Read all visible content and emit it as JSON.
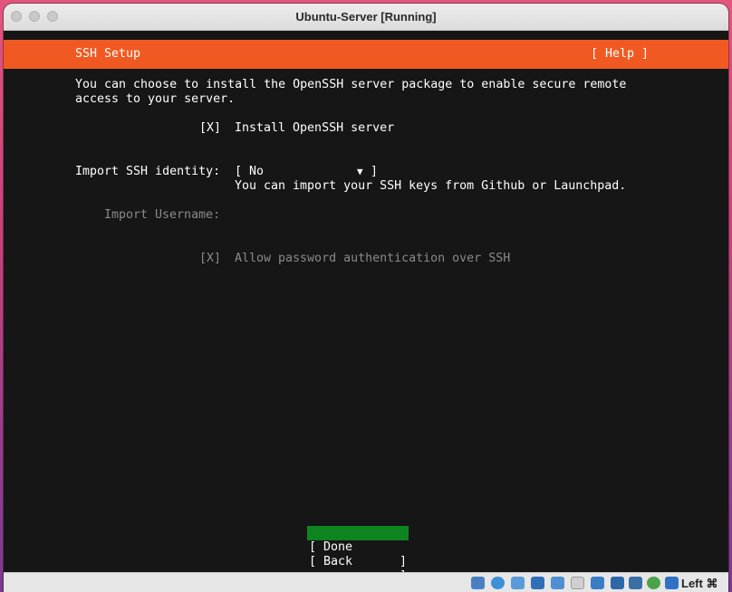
{
  "window": {
    "title": "Ubuntu-Server [Running]"
  },
  "header": {
    "title": "SSH Setup",
    "help": "[ Help ]"
  },
  "intro": {
    "line1": "You can choose to install the OpenSSH server package to enable secure remote",
    "line2": "access to your server."
  },
  "install_openssh": {
    "checkbox": "[X]",
    "label": "Install OpenSSH server"
  },
  "import_identity": {
    "label": "Import SSH identity:",
    "open_bracket": "[ No",
    "arrow": "▼",
    "close_bracket": "]",
    "hint": "You can import your SSH keys from Github or Launchpad."
  },
  "import_username": {
    "label": "Import Username:"
  },
  "allow_password": {
    "checkbox": "[X]",
    "label": "Allow password authentication over SSH"
  },
  "buttons": {
    "done": {
      "left": "[ Done",
      "right": "]"
    },
    "back": {
      "left": "[ Back",
      "right": "]"
    }
  },
  "statusbar": {
    "host_key": "Left ⌘",
    "icons": [
      "hard-disk-icon",
      "optical-disk-icon",
      "audio-icon",
      "network-icon",
      "usb-icon",
      "shared-folder-icon",
      "display-icon",
      "recording-icon",
      "cpu-icon",
      "mouse-integration-icon",
      "download-icon"
    ]
  },
  "colors": {
    "accent": "#f05a22",
    "done_bg": "#0e8420",
    "screen_bg": "#161616"
  }
}
